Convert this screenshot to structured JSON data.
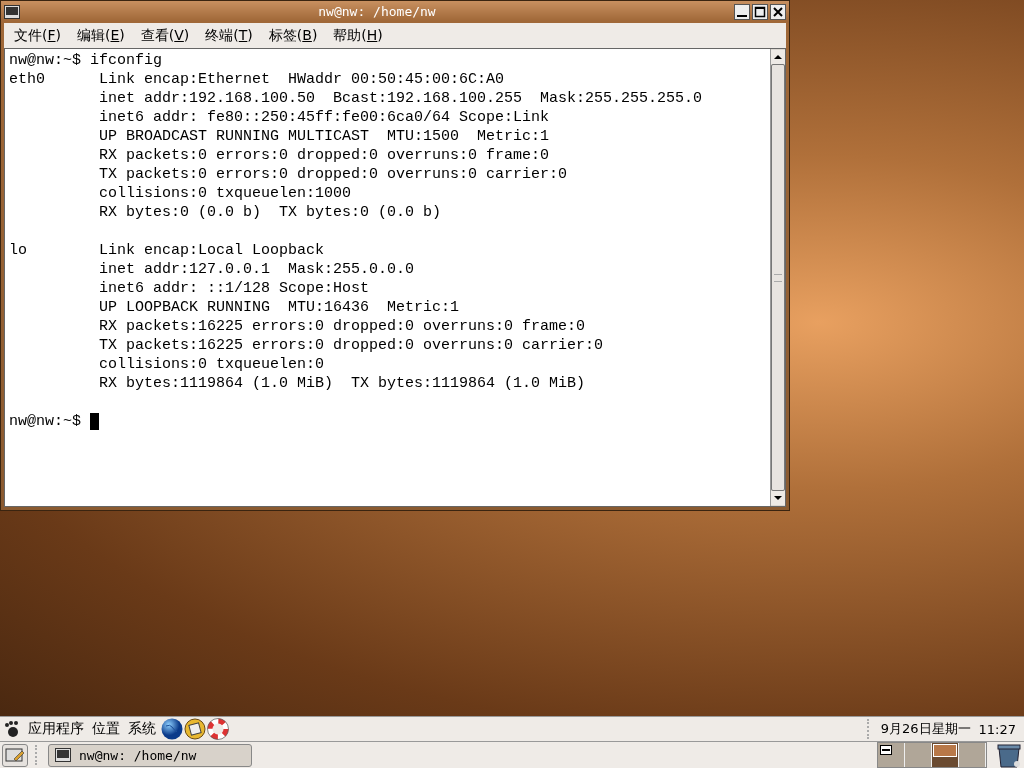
{
  "window": {
    "title": "nw@nw: /home/nw",
    "active": true
  },
  "menu": [
    {
      "label": "文件",
      "accelerator": "(F)"
    },
    {
      "label": "编辑",
      "accelerator": "(E)"
    },
    {
      "label": "查看",
      "accelerator": "(V)"
    },
    {
      "label": "终端",
      "accelerator": "(T)"
    },
    {
      "label": "标签",
      "accelerator": "(B)"
    },
    {
      "label": "帮助",
      "accelerator": "(H)"
    }
  ],
  "terminal": {
    "blocks": [
      {
        "lines": [
          "nw@nw:~$ ifconfig",
          "eth0      Link encap:Ethernet  HWaddr 00:50:45:00:6C:A0",
          "          inet addr:192.168.100.50  Bcast:192.168.100.255  Mask:255.255.255.0",
          "          inet6 addr: fe80::250:45ff:fe00:6ca0/64 Scope:Link",
          "          UP BROADCAST RUNNING MULTICAST  MTU:1500  Metric:1",
          "          RX packets:0 errors:0 dropped:0 overruns:0 frame:0",
          "          TX packets:0 errors:0 dropped:0 overruns:0 carrier:0",
          "          collisions:0 txqueuelen:1000",
          "          RX bytes:0 (0.0 b)  TX bytes:0 (0.0 b)"
        ]
      },
      {
        "lines": [
          "lo        Link encap:Local Loopback",
          "          inet addr:127.0.0.1  Mask:255.0.0.0",
          "          inet6 addr: ::1/128 Scope:Host",
          "          UP LOOPBACK RUNNING  MTU:16436  Metric:1",
          "          RX packets:16225 errors:0 dropped:0 overruns:0 frame:0",
          "          TX packets:16225 errors:0 dropped:0 overruns:0 carrier:0",
          "          collisions:0 txqueuelen:0",
          "          RX bytes:1119864 (1.0 MiB)  TX bytes:1119864 (1.0 MiB)"
        ]
      },
      {
        "lines": [
          "nw@nw:~$ "
        ]
      }
    ]
  },
  "top_panel": {
    "menus": [
      "应用程序",
      "位置",
      "系统"
    ],
    "date": "9月26日星期一",
    "time": "11:27"
  },
  "taskbar": {
    "tasks": [
      {
        "label": "nw@nw: /home/nw",
        "selected": false
      }
    ],
    "workspaces": [
      {
        "selected": false
      },
      {
        "selected": false
      },
      {
        "selected": true
      },
      {
        "selected": false
      }
    ]
  }
}
